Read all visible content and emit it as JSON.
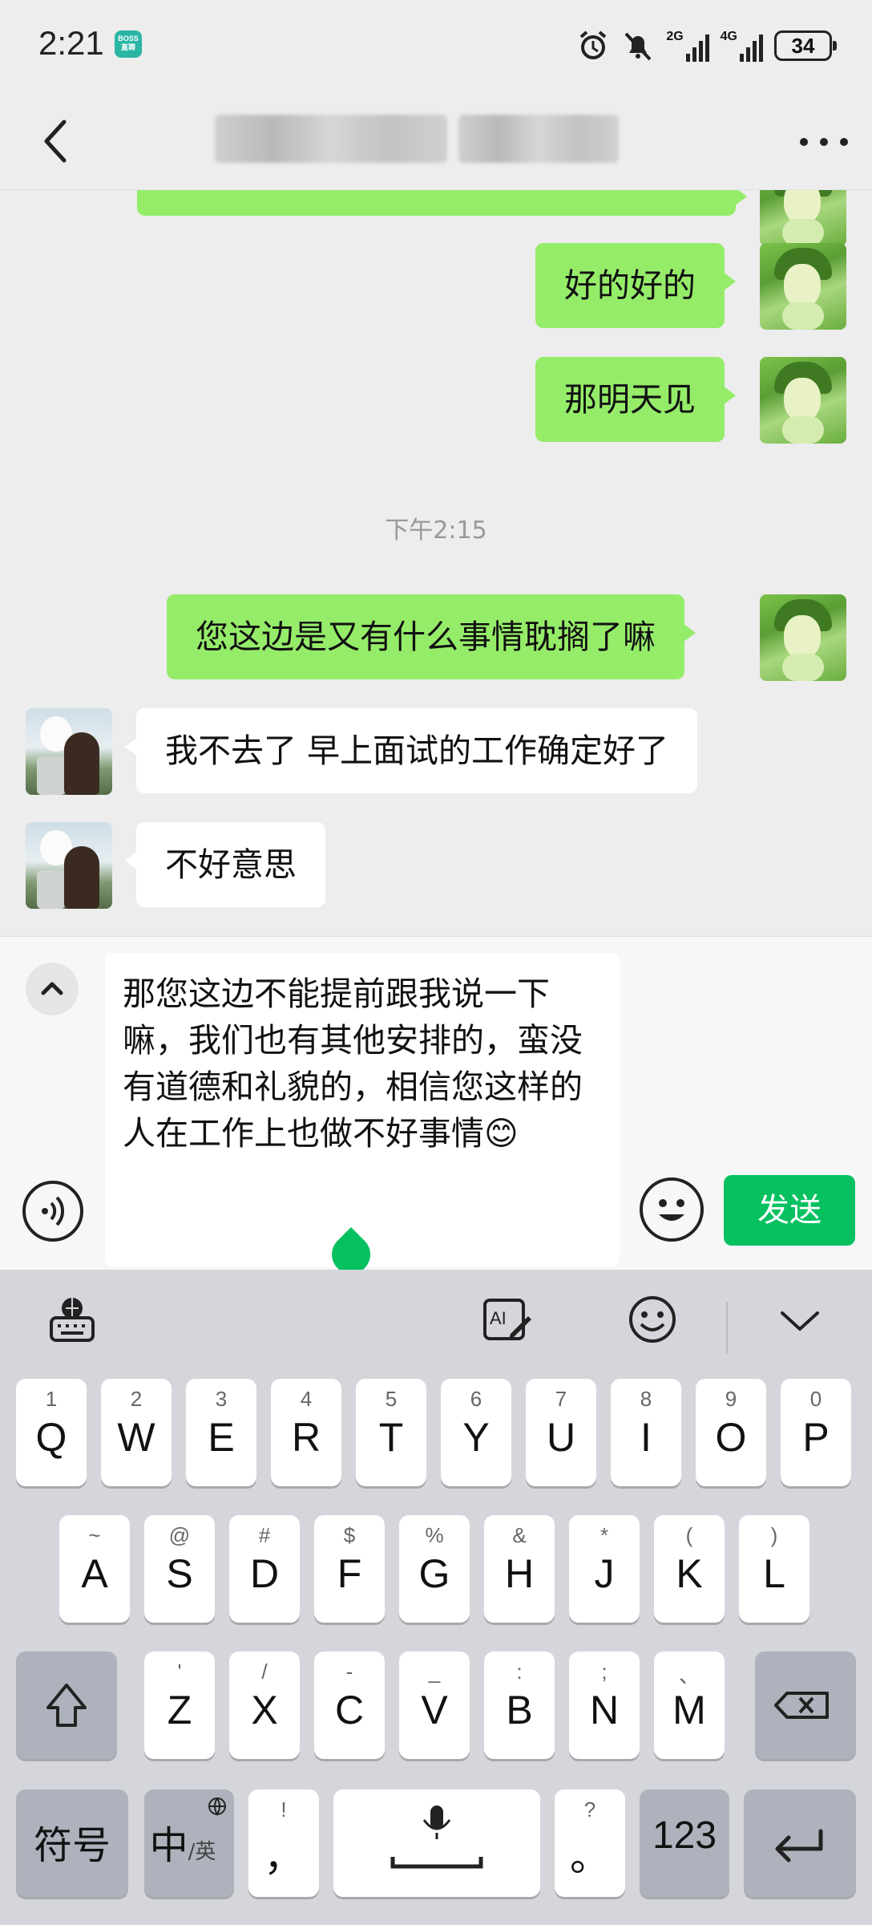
{
  "status_bar": {
    "time": "2:21",
    "app_badge": {
      "line1": "BOSS",
      "line2": "直聘"
    },
    "network_2g": "2G",
    "network_4g": "4G",
    "battery": "34"
  },
  "nav": {
    "contact_name_part1": "████",
    "contact_name_part2": "███"
  },
  "chat": {
    "messages": [
      {
        "side": "right",
        "text": "好的好的"
      },
      {
        "side": "right",
        "text": "那明天见"
      },
      {
        "side": "right",
        "text": "您这边是又有什么事情耽搁了嘛"
      },
      {
        "side": "left",
        "text": "我不去了 早上面试的工作确定好了"
      },
      {
        "side": "left",
        "text": "不好意思"
      }
    ],
    "timestamp": "下午2:15"
  },
  "input": {
    "draft": "那您这边不能提前跟我说一下嘛，我们也有其他安排的，蛮没有道德和礼貌的，相信您这样的人在工作上也做不好事情😊",
    "send_label": "发送"
  },
  "keyboard": {
    "row1": [
      {
        "hint": "1",
        "key": "Q"
      },
      {
        "hint": "2",
        "key": "W"
      },
      {
        "hint": "3",
        "key": "E"
      },
      {
        "hint": "4",
        "key": "R"
      },
      {
        "hint": "5",
        "key": "T"
      },
      {
        "hint": "6",
        "key": "Y"
      },
      {
        "hint": "7",
        "key": "U"
      },
      {
        "hint": "8",
        "key": "I"
      },
      {
        "hint": "9",
        "key": "O"
      },
      {
        "hint": "0",
        "key": "P"
      }
    ],
    "row2": [
      {
        "hint": "~",
        "key": "A"
      },
      {
        "hint": "@",
        "key": "S"
      },
      {
        "hint": "#",
        "key": "D"
      },
      {
        "hint": "$",
        "key": "F"
      },
      {
        "hint": "%",
        "key": "G"
      },
      {
        "hint": "&",
        "key": "H"
      },
      {
        "hint": "*",
        "key": "J"
      },
      {
        "hint": "(",
        "key": "K"
      },
      {
        "hint": ")",
        "key": "L"
      }
    ],
    "row3": [
      {
        "hint": "'",
        "key": "Z"
      },
      {
        "hint": "/",
        "key": "X"
      },
      {
        "hint": "-",
        "key": "C"
      },
      {
        "hint": "_",
        "key": "V"
      },
      {
        "hint": ":",
        "key": "B"
      },
      {
        "hint": ";",
        "key": "N"
      },
      {
        "hint": "、",
        "key": "M"
      }
    ],
    "symbols_label": "符号",
    "lang_label_main": "中",
    "lang_label_sub": "/英",
    "comma_hint": "!",
    "comma_key": "，",
    "period_hint": "?",
    "period_key": "。",
    "num_label": "123"
  },
  "icons": {
    "back": "chevron-left-icon",
    "more": "more-dots-icon",
    "voice": "voice-icon",
    "emoji": "smiley-icon",
    "collapse": "chevron-up-icon",
    "send_color": "#07c160",
    "my_bubble_color": "#95ec69"
  }
}
